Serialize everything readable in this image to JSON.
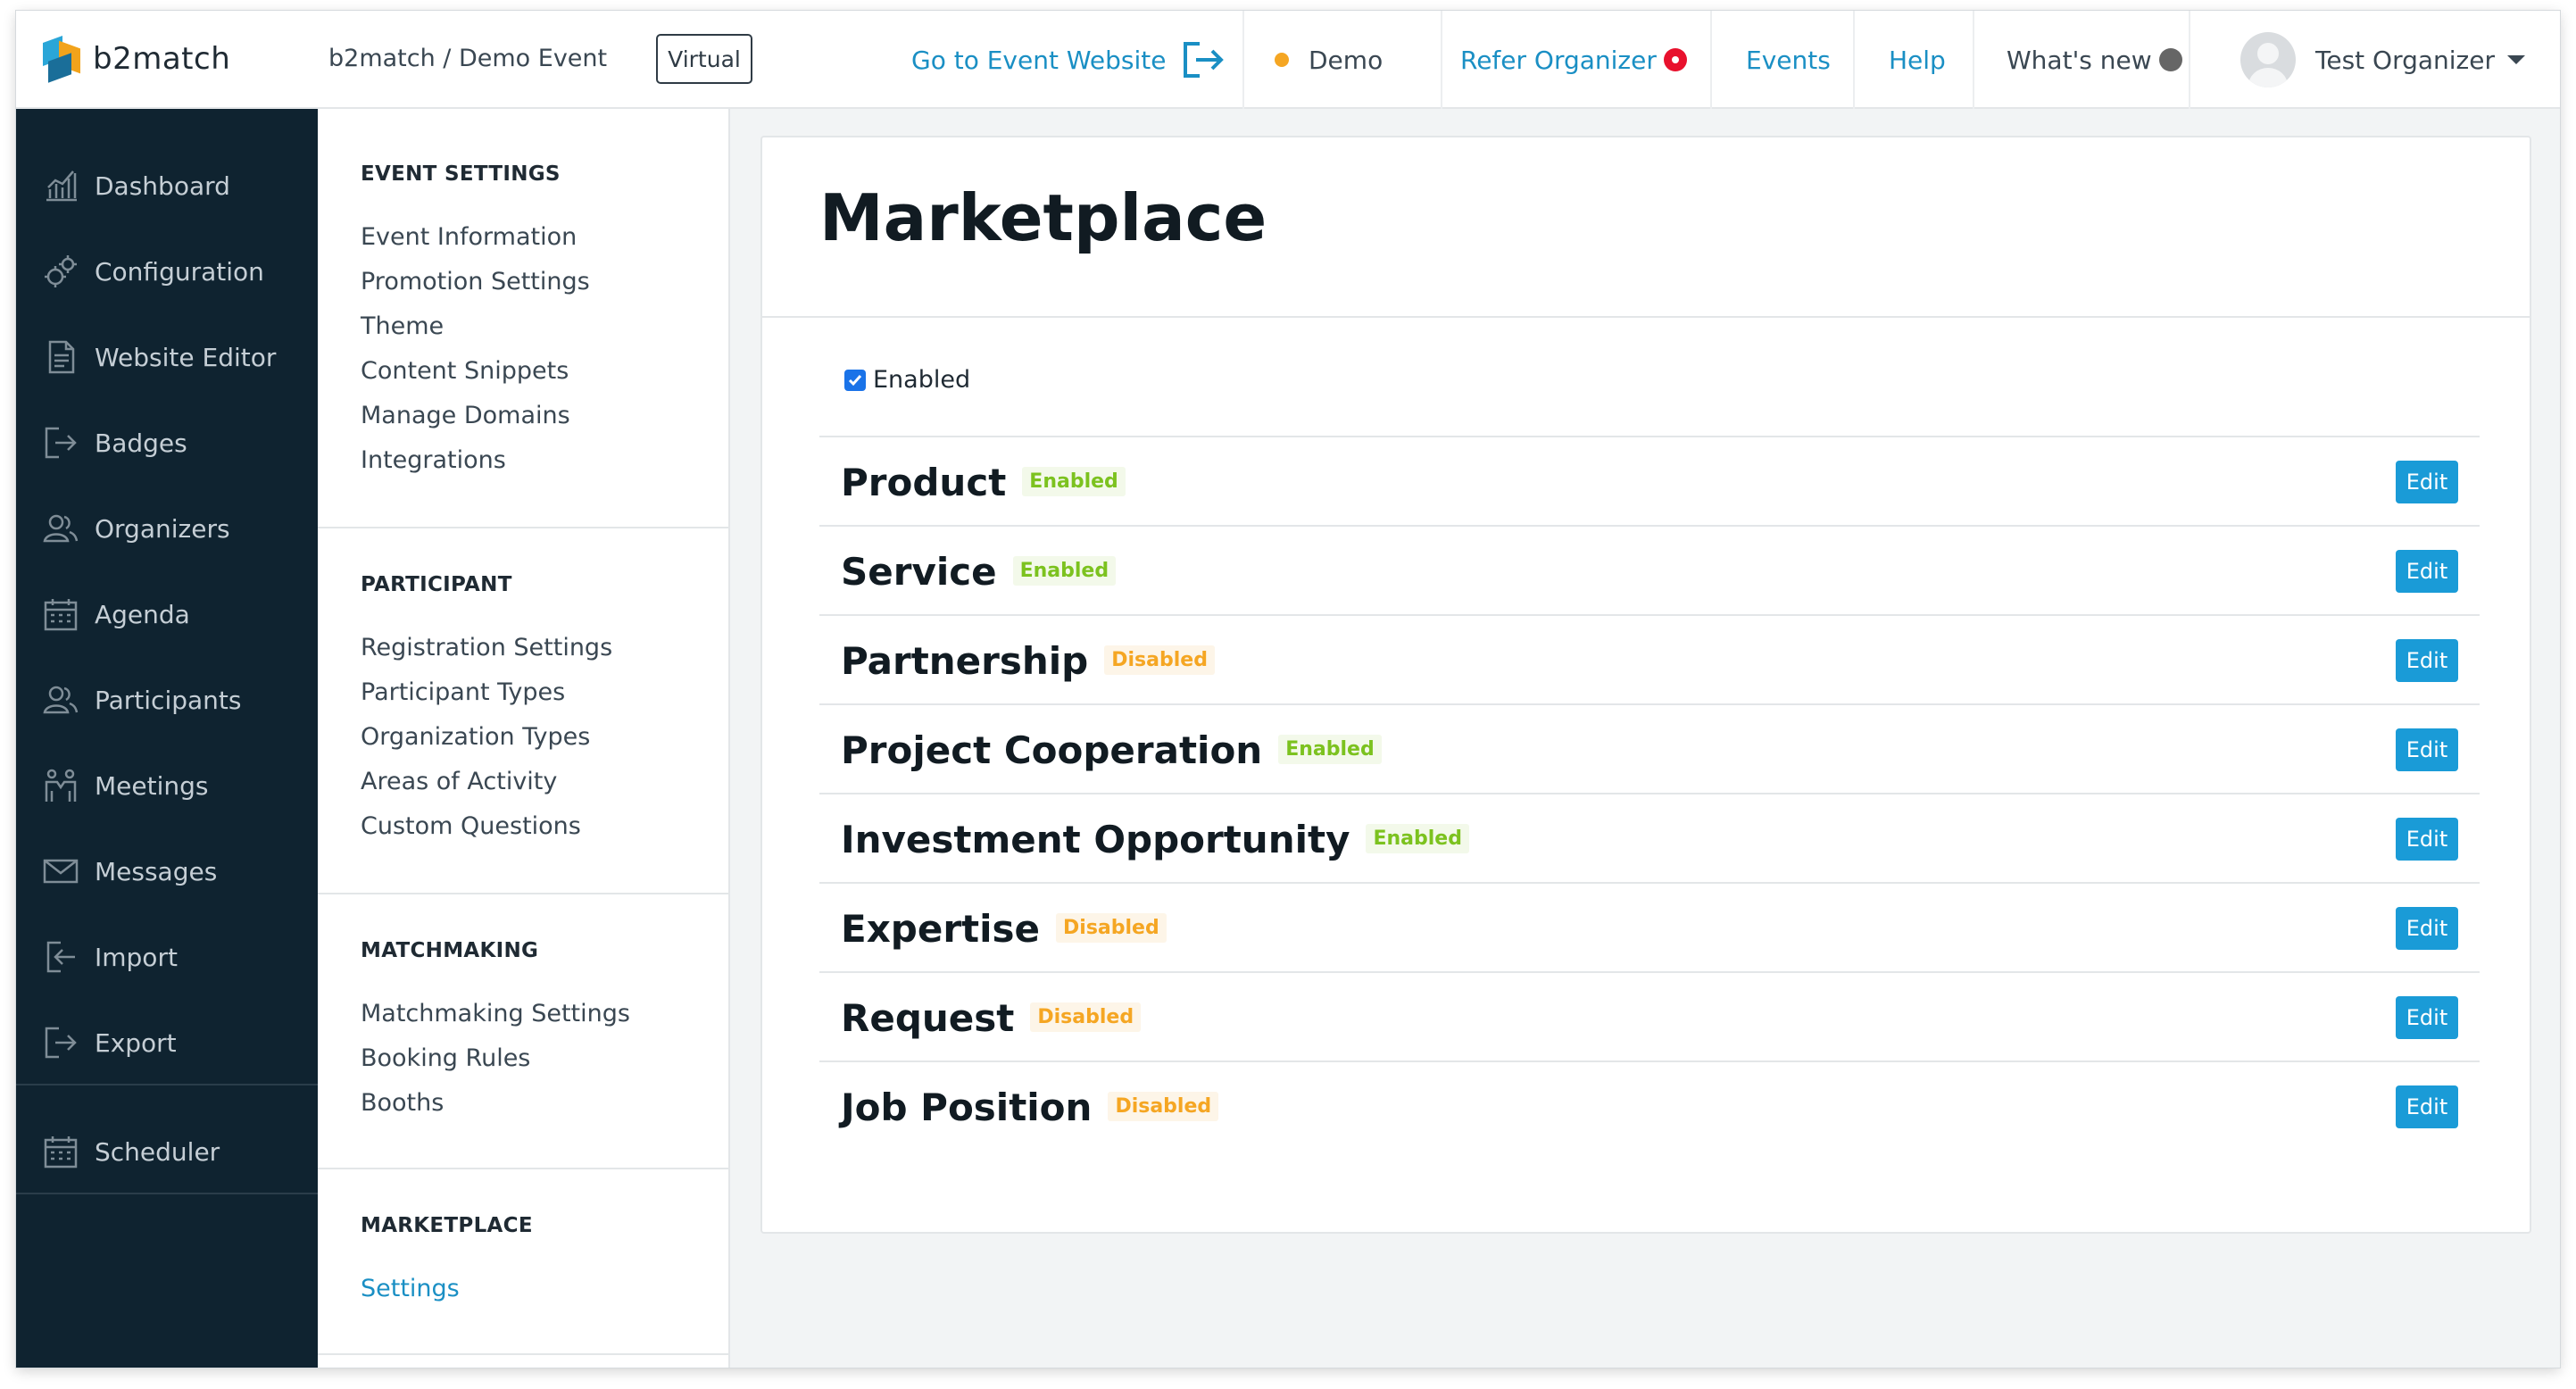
{
  "header": {
    "logo_text": "b2match",
    "breadcrumb": "b2match / Demo Event",
    "virtual_badge": "Virtual",
    "go_to_website": "Go to Event Website",
    "demo": "Demo",
    "refer_organizer": "Refer Organizer",
    "events": "Events",
    "help": "Help",
    "whats_new": "What's new",
    "user_name": "Test Organizer"
  },
  "sidebar": {
    "items": [
      {
        "label": "Dashboard",
        "icon": "chart-icon"
      },
      {
        "label": "Configuration",
        "icon": "gears-icon"
      },
      {
        "label": "Website Editor",
        "icon": "document-icon"
      },
      {
        "label": "Badges",
        "icon": "export-arrow-icon"
      },
      {
        "label": "Organizers",
        "icon": "people-icon"
      },
      {
        "label": "Agenda",
        "icon": "calendar-icon"
      },
      {
        "label": "Participants",
        "icon": "people-icon"
      },
      {
        "label": "Meetings",
        "icon": "handshake-icon"
      },
      {
        "label": "Messages",
        "icon": "envelope-icon"
      },
      {
        "label": "Import",
        "icon": "import-icon"
      },
      {
        "label": "Export",
        "icon": "export-icon"
      }
    ],
    "scheduler": {
      "label": "Scheduler",
      "icon": "calendar-icon"
    }
  },
  "settings_nav": {
    "event_settings": {
      "title": "EVENT SETTINGS",
      "links": [
        "Event Information",
        "Promotion Settings",
        "Theme",
        "Content Snippets",
        "Manage Domains",
        "Integrations"
      ]
    },
    "participant": {
      "title": "PARTICIPANT",
      "links": [
        "Registration Settings",
        "Participant Types",
        "Organization Types",
        "Areas of Activity",
        "Custom Questions"
      ]
    },
    "matchmaking": {
      "title": "MATCHMAKING",
      "links": [
        "Matchmaking Settings",
        "Booking Rules",
        "Booths"
      ]
    },
    "marketplace": {
      "title": "MARKETPLACE",
      "links": [
        "Settings"
      ]
    }
  },
  "main": {
    "title": "Marketplace",
    "enabled_label": "Enabled",
    "enabled_checked": true,
    "edit_label": "Edit",
    "rows": [
      {
        "name": "Product",
        "status": "Enabled"
      },
      {
        "name": "Service",
        "status": "Enabled"
      },
      {
        "name": "Partnership",
        "status": "Disabled"
      },
      {
        "name": "Project Cooperation",
        "status": "Enabled"
      },
      {
        "name": "Investment Opportunity",
        "status": "Enabled"
      },
      {
        "name": "Expertise",
        "status": "Disabled"
      },
      {
        "name": "Request",
        "status": "Disabled"
      },
      {
        "name": "Job Position",
        "status": "Disabled"
      }
    ]
  },
  "colors": {
    "sidebar_bg": "#0f2330",
    "link_blue": "#1a8fc4",
    "edit_button": "#1a9bd7",
    "status_enabled": "#7cc21f",
    "status_disabled": "#f5a623",
    "demo_dot": "#f5a623",
    "refer_dot": "#e8112d",
    "whats_new_dot": "#666666"
  }
}
